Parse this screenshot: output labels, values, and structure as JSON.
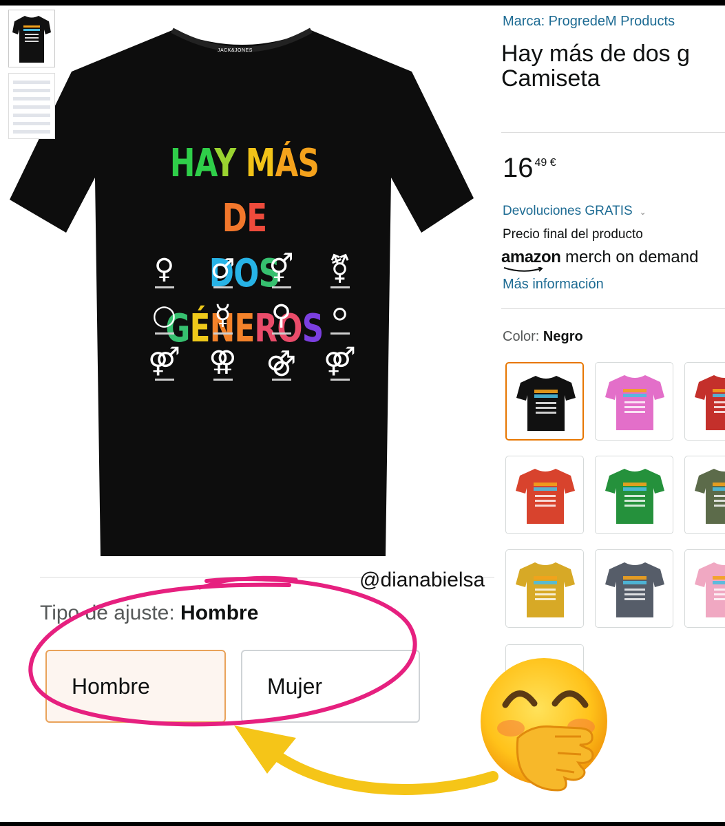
{
  "thumbnails": [
    {
      "title_lines": [
        "HAY MÁS DE",
        "DOS GÉNEROS"
      ]
    },
    {}
  ],
  "product_image": {
    "brand_tag": "JACK&JONES",
    "title_lines": [
      "HAY MÁS DE",
      "DOS GÉNEROS"
    ],
    "title_colors": [
      [
        "#2fce49",
        "#9ad330",
        "#f2c318",
        "#f4a21c",
        "#f2772c",
        "#ee4b3c"
      ],
      [
        "#27b3e6",
        "#36c06f",
        "#eec91a",
        "#f3822a",
        "#ea4c6a",
        "#7b3fe0"
      ]
    ],
    "symbols": [
      "♀",
      "♂",
      "⚥",
      "⚧",
      "○",
      "☿",
      "⚲",
      "⚪",
      "⚤",
      "⚢",
      "⚣",
      "⚤"
    ],
    "watermark": "@dianabielsa"
  },
  "marca": "Marca: ProgredeM Products",
  "title_lines": [
    "Hay más de dos g",
    "Camiseta"
  ],
  "price": {
    "main": "16",
    "cents": "49 €"
  },
  "returns": "Devoluciones GRATIS",
  "returns_chevron": "⌄",
  "final_price_note": "Precio final del producto",
  "merch": {
    "amazon": "amazon",
    "rest": " merch on demand"
  },
  "more_info": "Más información",
  "color": {
    "label": "Color:",
    "value": "Negro"
  },
  "swatches": [
    {
      "color": "#111111",
      "selected": true
    },
    {
      "color": "#e36fc9",
      "selected": false
    },
    {
      "color": "#c4302b",
      "selected": false
    },
    {
      "color": "#d8432d",
      "selected": false
    },
    {
      "color": "#25913c",
      "selected": false
    },
    {
      "color": "#5c6b4a",
      "selected": false
    },
    {
      "color": "#d7a926",
      "selected": false
    },
    {
      "color": "#565d69",
      "selected": false
    },
    {
      "color": "#f0a8c2",
      "selected": false
    },
    {
      "color": "#ffffff",
      "selected": false
    }
  ],
  "fit": {
    "label": "Tipo de ajuste:",
    "value": "Hombre",
    "options": [
      "Hombre",
      "Mujer"
    ],
    "selected": "Hombre"
  },
  "annotation": {
    "circle_color": "#e6207f",
    "arrow_color": "#f5c518",
    "emoji": "hand-over-mouth-emoji"
  }
}
